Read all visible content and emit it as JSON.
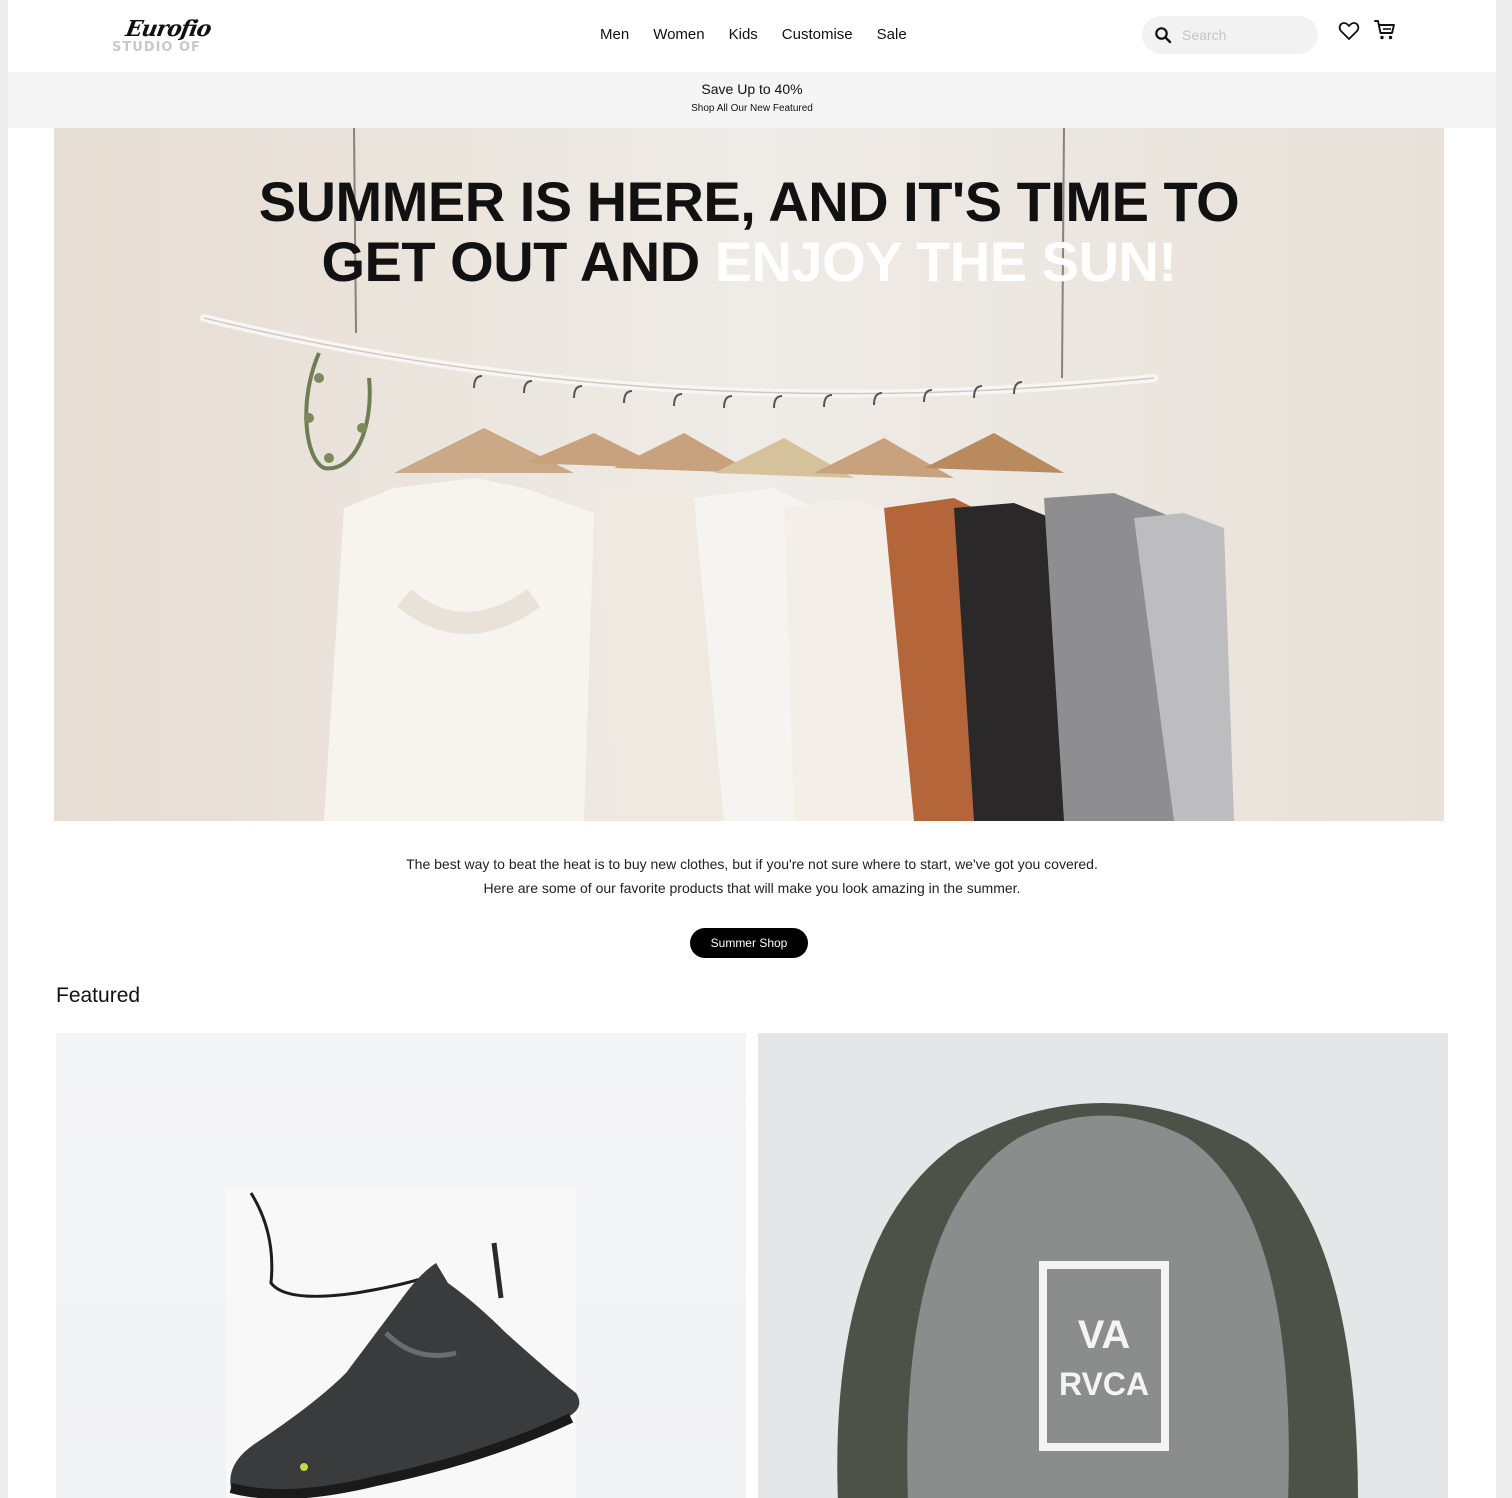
{
  "header": {
    "logo_script": "Eurofio",
    "logo_sub": "STUDIO OF",
    "nav": [
      "Men",
      "Women",
      "Kids",
      "Customise",
      "Sale"
    ],
    "search_placeholder": "Search",
    "icons": [
      "search-icon",
      "heart-icon",
      "cart-icon"
    ]
  },
  "promo": {
    "title": "Save Up to 40%",
    "subtitle": "Shop All Our New Featured"
  },
  "hero": {
    "title_line1": "SUMMER IS HERE, AND IT'S TIME TO",
    "title_line2_dark": "GET OUT AND ",
    "title_line2_light": "ENJOY THE SUN!"
  },
  "intro": {
    "line1": "The best way to beat the heat is to buy new clothes, but if you're not sure where to start, we've got you covered.",
    "line2": "Here are some of our favorite products that will make you look amazing in the summer.",
    "cta": "Summer Shop"
  },
  "featured": {
    "title": "Featured",
    "cap_text_top": "VA",
    "cap_text_bottom": "RVCA"
  },
  "colors": {
    "accent": "#000000",
    "promo_bg": "#f5f5f5",
    "hero_bg": "#ebe4dc"
  }
}
